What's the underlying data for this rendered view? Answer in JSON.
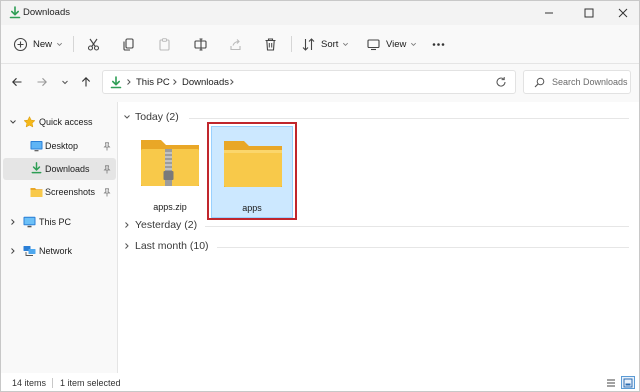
{
  "window": {
    "title": "Downloads"
  },
  "toolbar": {
    "new_label": "New",
    "sort_label": "Sort",
    "view_label": "View"
  },
  "address": {
    "crumbs": [
      "This PC",
      "Downloads"
    ]
  },
  "search": {
    "placeholder": "Search Downloads"
  },
  "navpane": {
    "items": [
      {
        "label": "Quick access",
        "icon": "star-icon"
      },
      {
        "label": "Desktop",
        "icon": "desktop-icon",
        "pinned": true
      },
      {
        "label": "Downloads",
        "icon": "download-icon",
        "pinned": true,
        "selected": true
      },
      {
        "label": "Screenshots",
        "icon": "folder-icon",
        "pinned": true
      },
      {
        "label": "This PC",
        "icon": "pc-icon"
      },
      {
        "label": "Network",
        "icon": "network-icon"
      }
    ]
  },
  "content": {
    "groups": [
      {
        "label": "Today (2)",
        "expanded": true
      },
      {
        "label": "Yesterday (2)",
        "expanded": false
      },
      {
        "label": "Last month (10)",
        "expanded": false
      }
    ],
    "files": [
      {
        "name": "apps.zip",
        "icon": "zip-folder-icon",
        "selected": false
      },
      {
        "name": "apps",
        "icon": "folder-icon",
        "selected": true
      }
    ]
  },
  "status": {
    "items_count": "14 items",
    "selection": "1 item selected"
  },
  "colors": {
    "selection_bg": "#cce8ff",
    "highlight_border": "#c0262d",
    "folder_yellow": "#f8c94a",
    "accent_green": "#2e9e55"
  }
}
